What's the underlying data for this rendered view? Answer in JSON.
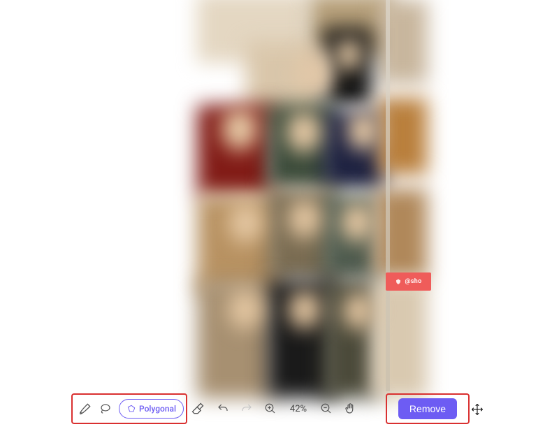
{
  "tools": {
    "polygonal_label": "Polygonal"
  },
  "zoom": {
    "level_label": "42%"
  },
  "actions": {
    "remove_label": "Remove"
  },
  "watermark": {
    "handle_label": "@sho"
  },
  "colors": {
    "accent": "#6d5cf3",
    "highlight_box": "#d93030",
    "wm_bg": "#ef5c5a"
  }
}
